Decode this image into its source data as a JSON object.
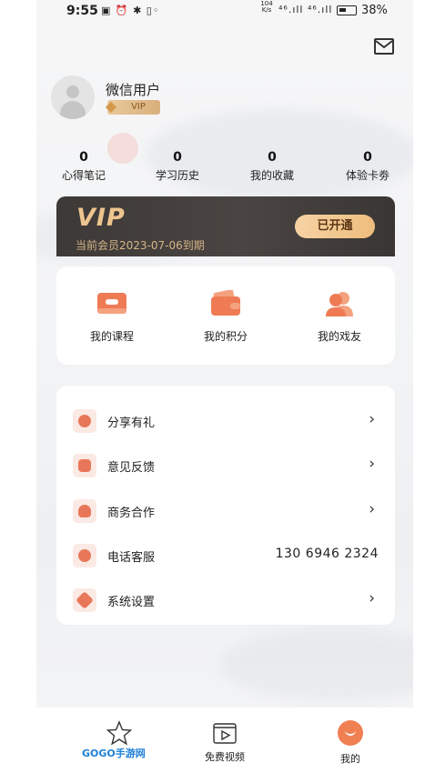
{
  "status_bar": {
    "time": "9:55",
    "network_speed": "104 K/s",
    "signal": "⁴⁶.ıll ⁴⁶.ıll",
    "battery": "38%"
  },
  "profile": {
    "username": "微信用户",
    "badge": "VIP"
  },
  "stats": [
    {
      "count": "0",
      "label": "心得笔记"
    },
    {
      "count": "0",
      "label": "学习历史"
    },
    {
      "count": "0",
      "label": "我的收藏"
    },
    {
      "count": "0",
      "label": "体验卡劵"
    }
  ],
  "vip_card": {
    "logo": "VIP",
    "expire_text": "当前会员2023-07-06到期",
    "status_button": "已开通"
  },
  "quick_actions": [
    {
      "label": "我的课程",
      "icon": "course-card-icon"
    },
    {
      "label": "我的积分",
      "icon": "wallet-icon"
    },
    {
      "label": "我的戏友",
      "icon": "friends-icon"
    }
  ],
  "menu": [
    {
      "label": "分享有礼",
      "icon": "share-icon",
      "chevron": "›"
    },
    {
      "label": "意见反馈",
      "icon": "feedback-icon",
      "chevron": "›"
    },
    {
      "label": "商务合作",
      "icon": "handshake-heart-icon",
      "chevron": "›"
    },
    {
      "label": "电话客服",
      "icon": "customer-service-icon",
      "value": "130 6946 2324"
    },
    {
      "label": "系统设置",
      "icon": "gear-icon",
      "chevron": "›"
    }
  ],
  "tabbar": {
    "home_label": "",
    "video_label": "免费视频",
    "mine_label": "我的",
    "watermark": "GOGO手游网"
  },
  "colors": {
    "accent": "#f07f52",
    "vip_gold": "#edc58e",
    "vip_card_bg": "#3d3937"
  }
}
